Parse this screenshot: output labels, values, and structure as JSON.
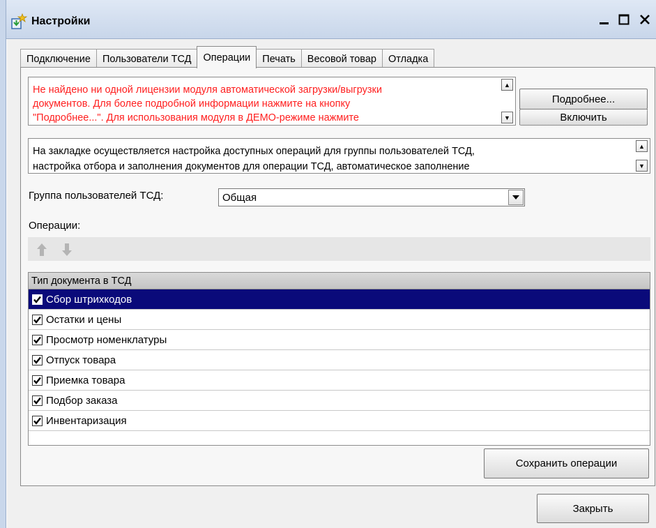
{
  "window": {
    "title": "Настройки"
  },
  "tabs": [
    {
      "label": "Подключение",
      "active": false
    },
    {
      "label": "Пользователи ТСД",
      "active": false
    },
    {
      "label": "Операции",
      "active": true
    },
    {
      "label": "Печать",
      "active": false
    },
    {
      "label": "Весовой товар",
      "active": false
    },
    {
      "label": "Отладка",
      "active": false
    }
  ],
  "license": {
    "lines": [
      "Не найдено ни одной лицензии модуля автоматической загрузки/выгрузки",
      "документов. Для более подробной информации нажмите на кнопку",
      "\"Подробнее...\". Для использования модуля в ДЕМО-режиме нажмите"
    ],
    "more_label": "Подробнее...",
    "enable_label": "Включить",
    "text_color": "#ff2020"
  },
  "description": {
    "lines": [
      "На закладке осуществляется настройка доступных операций для группы пользователей ТСД,",
      "настройка отбора  и  заполнения  документов  для операции ТСД, автоматическое заполнение"
    ]
  },
  "group": {
    "label": "Группа пользователей ТСД:",
    "value": "Общая"
  },
  "operations": {
    "label": "Операции:",
    "column_header": "Тип документа в ТСД",
    "rows": [
      {
        "label": "Сбор штрихкодов",
        "checked": true,
        "selected": true
      },
      {
        "label": "Остатки и цены",
        "checked": true,
        "selected": false
      },
      {
        "label": "Просмотр номенклатуры",
        "checked": true,
        "selected": false
      },
      {
        "label": "Отпуск товара",
        "checked": true,
        "selected": false
      },
      {
        "label": "Приемка товара",
        "checked": true,
        "selected": false
      },
      {
        "label": "Подбор заказа",
        "checked": true,
        "selected": false
      },
      {
        "label": "Инвентаризация",
        "checked": true,
        "selected": false
      }
    ],
    "selection_color": "#0a0a7a"
  },
  "buttons": {
    "save_label": "Сохранить операции",
    "close_label": "Закрыть"
  },
  "icons": {
    "app": "settings-app-icon",
    "move_up": "arrow-up-icon",
    "move_down": "arrow-down-icon"
  }
}
